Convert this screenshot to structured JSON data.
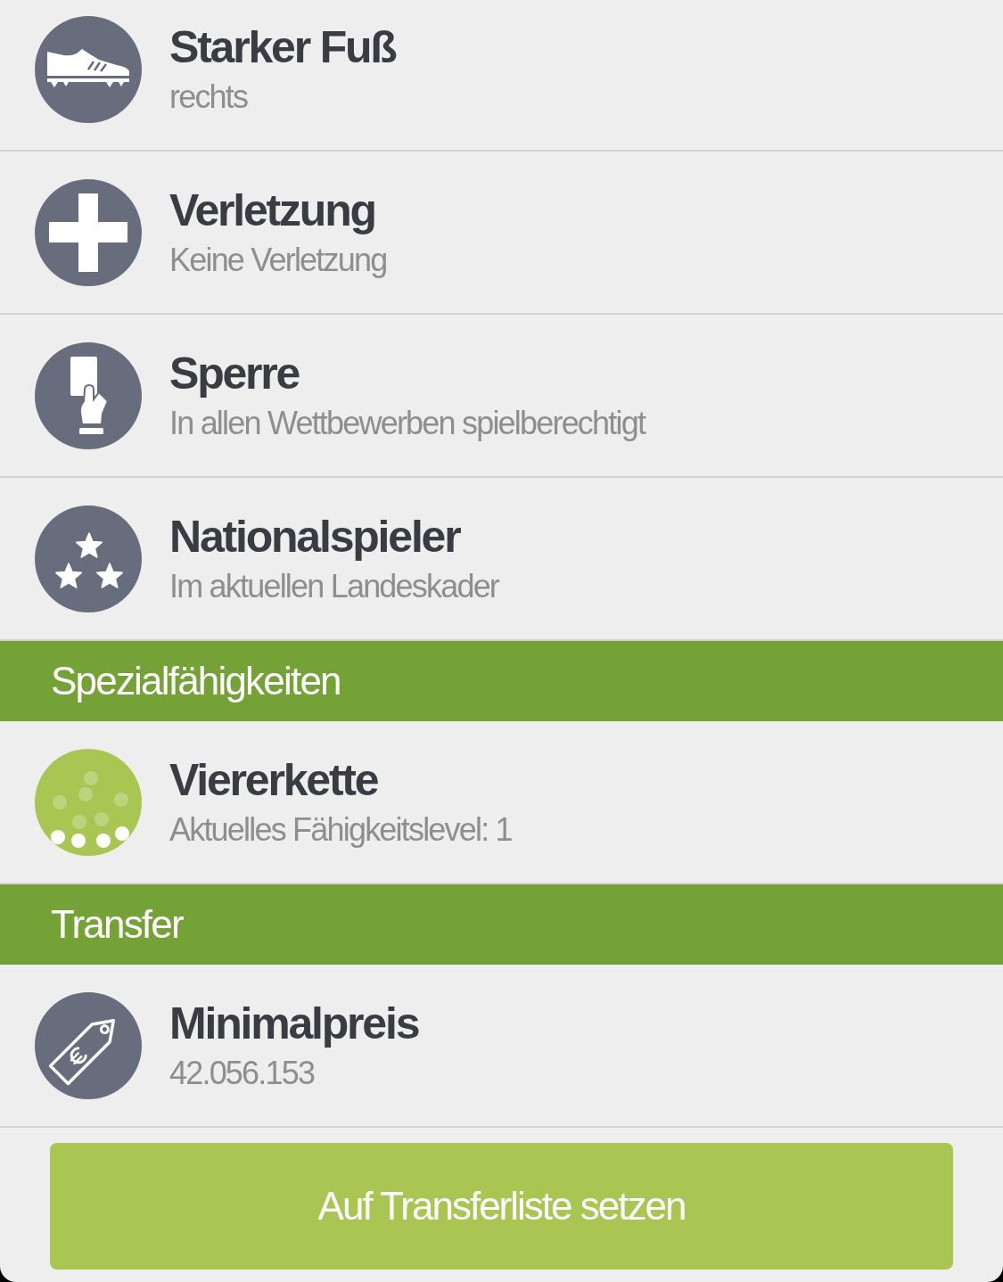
{
  "info_rows": [
    {
      "kind": "foot",
      "title": "Starker Fuß",
      "subtitle": "rechts"
    },
    {
      "kind": "injury",
      "title": "Verletzung",
      "subtitle": "Keine Verletzung"
    },
    {
      "kind": "suspension",
      "title": "Sperre",
      "subtitle": "In allen Wettbewerben spielberechtigt"
    },
    {
      "kind": "national",
      "title": "Nationalspieler",
      "subtitle": "Im aktuellen Landeskader"
    }
  ],
  "sections": [
    {
      "title": "Spezialfähigkeiten",
      "rows": [
        {
          "kind": "skill",
          "title": "Viererkette",
          "subtitle": "Aktuelles Fähigkeitslevel: 1"
        }
      ]
    },
    {
      "title": "Transfer",
      "rows": [
        {
          "kind": "price",
          "title": "Minimalpreis",
          "subtitle": "42.056.153"
        }
      ]
    }
  ],
  "action_button": {
    "label": "Auf Transferliste setzen"
  }
}
